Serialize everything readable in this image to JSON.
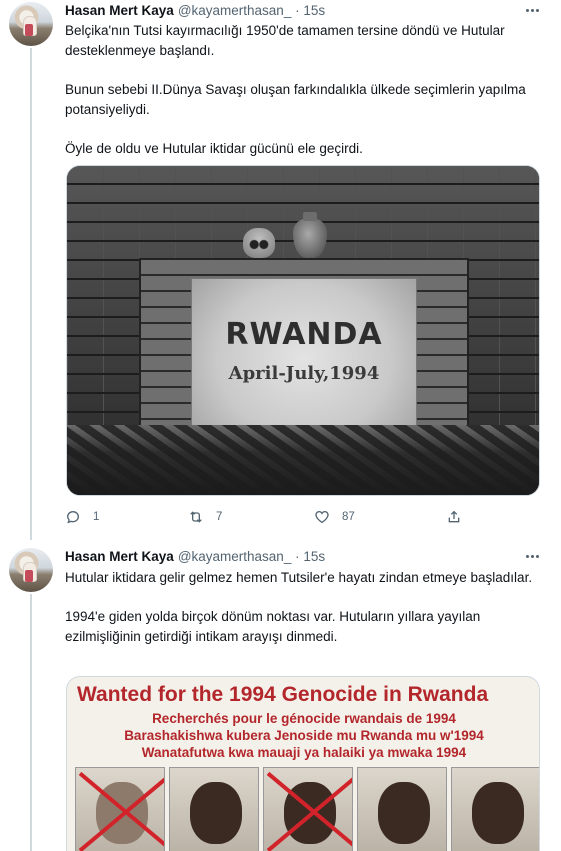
{
  "tweets": [
    {
      "author_name": "Hasan Mert Kaya",
      "handle_time": "@kayamerthasan_ · 15s",
      "paragraphs": [
        "Belçika'nın Tutsi kayırmacılığı 1950'de tamamen tersine döndü ve Hutular desteklenmeye başlandı.",
        "Bunun sebebi II.Dünya Savaşı oluşan farkındalıkla ülkede seçimlerin yapılma potansiyeliydi.",
        "Öyle de oldu ve Hutular iktidar gücünü ele geçirdi."
      ],
      "image_text": {
        "line1": "RWANDA",
        "line2": "April-July,1994"
      },
      "actions": {
        "replies": "1",
        "retweets": "7",
        "likes": "87"
      }
    },
    {
      "author_name": "Hasan Mert Kaya",
      "handle_time": "@kayamerthasan_ · 15s",
      "paragraphs": [
        "Hutular iktidara gelir gelmez hemen Tutsiler'e hayatı zindan etmeye başladılar.",
        "1994'e giden yolda birçok dönüm noktası var. Hutuların yıllara yayılan ezilmişliğinin getirdiği intikam arayışı dinmedi."
      ],
      "image_text": {
        "title": "Wanted for the 1994 Genocide in Rwanda",
        "line1": "Recherchés pour le génocide rwandais de 1994",
        "line2": "Barashakishwa kubera Jenoside mu Rwanda mu w'1994",
        "line3": "Wanatafutwa kwa mauaji ya halaiki ya mwaka 1994"
      }
    }
  ],
  "colors": {
    "text": "#0f1419",
    "secondary": "#536471",
    "thread_line": "#cfd9de",
    "poster_red": "#b3262b"
  },
  "icons": [
    "more-icon",
    "reply-icon",
    "retweet-icon",
    "like-icon",
    "share-icon"
  ]
}
